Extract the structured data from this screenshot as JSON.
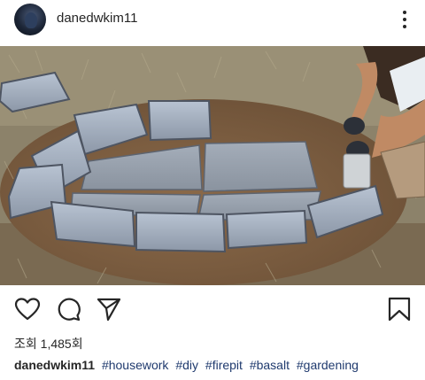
{
  "post": {
    "username": "danedwkim11",
    "more_icon": "more-vertical-icon",
    "media_description_icon": "post-photo"
  },
  "actions": {
    "like_icon": "heart-icon",
    "comment_icon": "comment-icon",
    "share_icon": "paper-plane-icon",
    "save_icon": "bookmark-icon"
  },
  "stats": {
    "views_label": "조회",
    "views_count": "1,485회"
  },
  "caption": {
    "username": "danedwkim11",
    "hashtags": [
      "#housework",
      "#diy",
      "#firepit",
      "#basalt",
      "#gardening"
    ]
  },
  "colors": {
    "hashtag": "#1f3a6e",
    "text": "#262626"
  }
}
